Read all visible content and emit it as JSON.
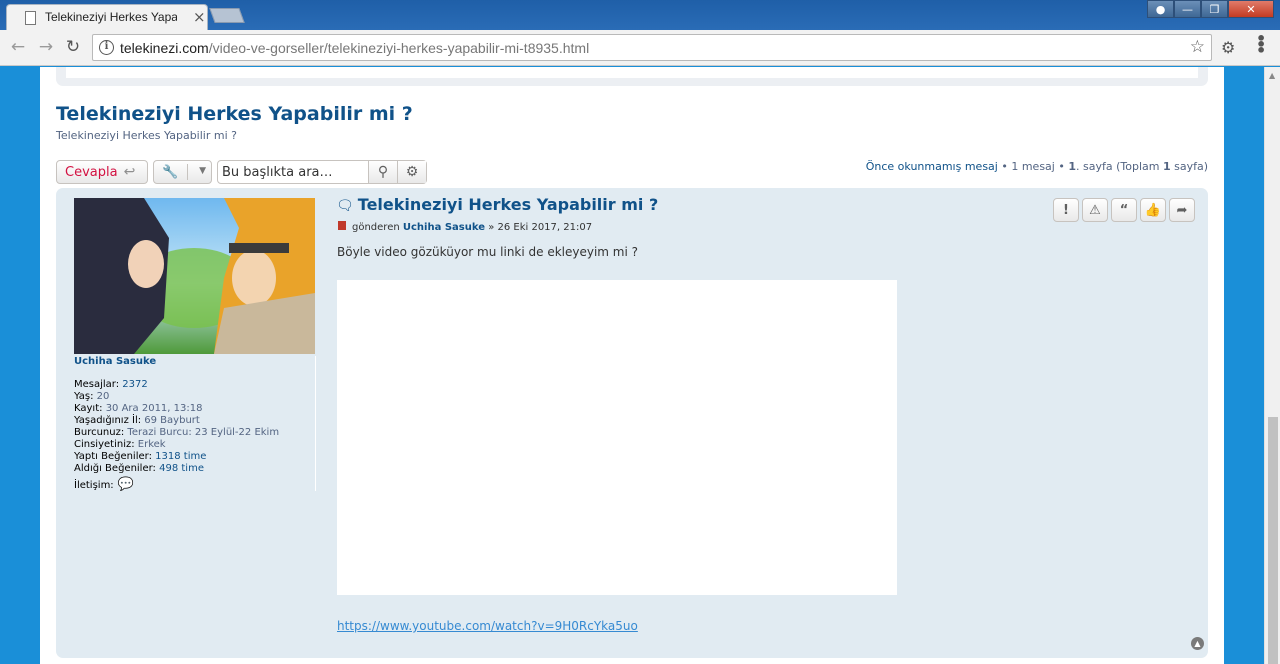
{
  "browser": {
    "tab_title": "Telekineziyi Herkes Yapabilir mi ?",
    "tab_close": "×",
    "url_host": "telekinezi.com",
    "url_path": "/video-ve-gorseller/telekineziyi-herkes-yapabilir-mi-t8935.html",
    "back_icon": "arrow-left-icon",
    "forward_icon": "arrow-right-icon",
    "reload_icon": "reload-icon",
    "bookmark_icon": "star-icon"
  },
  "topic": {
    "title": "Telekineziyi Herkes Yapabilir mi ?",
    "subtitle": "Telekineziyi Herkes Yapabilir mi ?"
  },
  "actions": {
    "reply_label": "Cevapla",
    "search_placeholder": "Bu başlıkta ara…"
  },
  "pagination": {
    "unread": "Önce okunmamış mesaj",
    "sep1": " • ",
    "count": "1 mesaj",
    "sep2": " • ",
    "page_num": "1",
    "page_text": ". sayfa (Toplam ",
    "total": "1",
    "page_end": " sayfa)"
  },
  "post": {
    "title": "Telekineziyi Herkes Yapabilir mi ?",
    "meta_prefix": "gönderen ",
    "author": "Uchiha Sasuke",
    "meta_date": " » 26 Eki 2017, 21:07",
    "body": "Böyle video gözüküyor mu linki de ekleyeyim mi ?",
    "link": "https://www.youtube.com/watch?v=9H0RcYka5uo"
  },
  "profile": {
    "username": "Uchiha Sasuke",
    "rows": [
      {
        "label": "Mesajlar:",
        "value": "2372"
      },
      {
        "label": "Yaş:",
        "value": "20"
      },
      {
        "label": "Kayıt:",
        "value": "30 Ara 2011, 13:18"
      },
      {
        "label": "Yaşadığınız İl:",
        "value": "69 Bayburt"
      },
      {
        "label": "Burcunuz:",
        "value": "Terazi Burcu: 23 Eylül-22 Ekim"
      },
      {
        "label": "Cinsiyetiniz:",
        "value": "Erkek"
      },
      {
        "label": "Yaptı Beğeniler:",
        "value": "1318 time"
      },
      {
        "label": "Aldığı Beğeniler:",
        "value": "498 time"
      }
    ],
    "contact_label": "İletişim:"
  },
  "colors": {
    "link": "#105289",
    "reply": "#d31141",
    "post_bg": "#e1ebf2",
    "page_bg": "#1a8fd8"
  }
}
